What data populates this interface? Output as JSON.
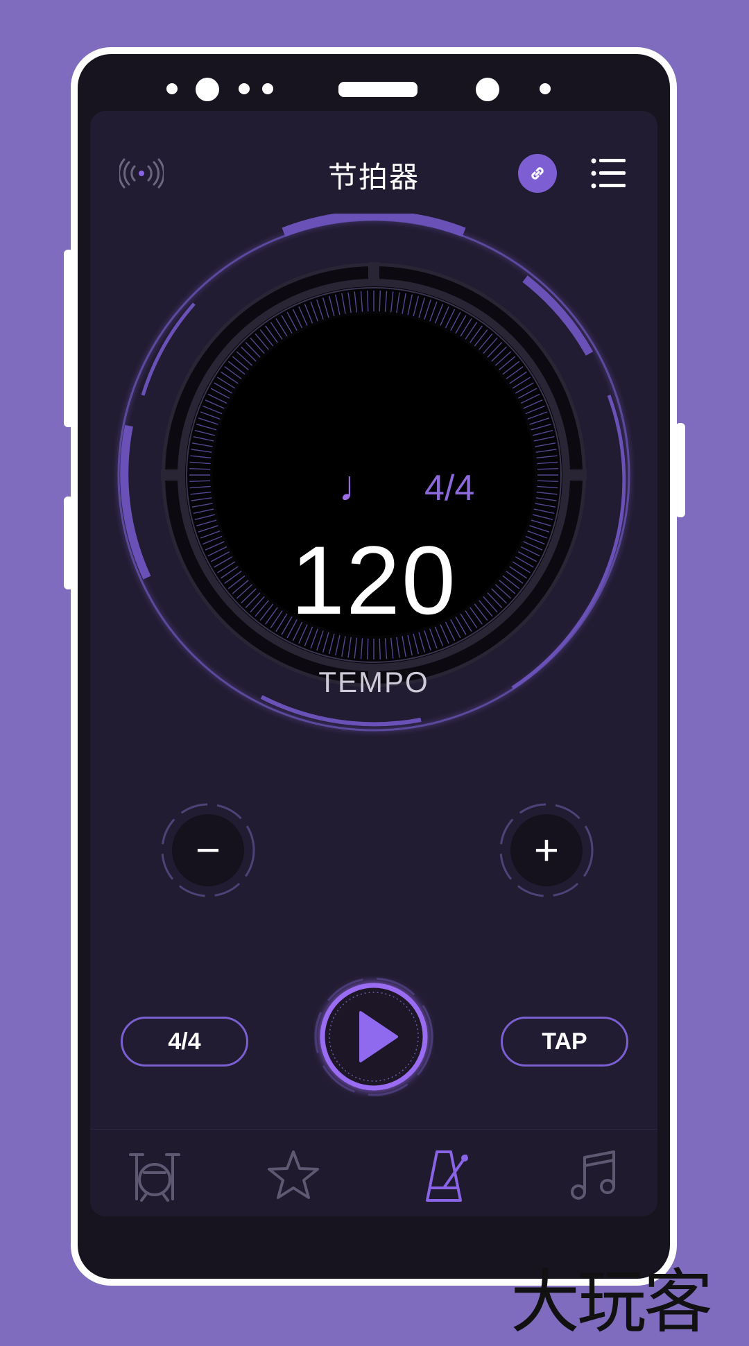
{
  "header": {
    "title": "节拍器"
  },
  "dial": {
    "note_glyph": "♩",
    "time_signature": "4/4",
    "tempo": "120",
    "tempo_label": "TEMPO"
  },
  "controls": {
    "decrease_label": "−",
    "increase_label": "+",
    "time_signature_button": "4/4",
    "tap_button": "TAP"
  },
  "tabs": [
    {
      "icon": "drum-kit-icon",
      "active": false
    },
    {
      "icon": "star-icon",
      "active": false
    },
    {
      "icon": "metronome-icon",
      "active": true
    },
    {
      "icon": "music-note-icon",
      "active": false
    }
  ],
  "colors": {
    "accent": "#8a64e6",
    "background": "#221c32",
    "outer_bg": "#7f6cbf"
  },
  "watermark": "大玩客"
}
